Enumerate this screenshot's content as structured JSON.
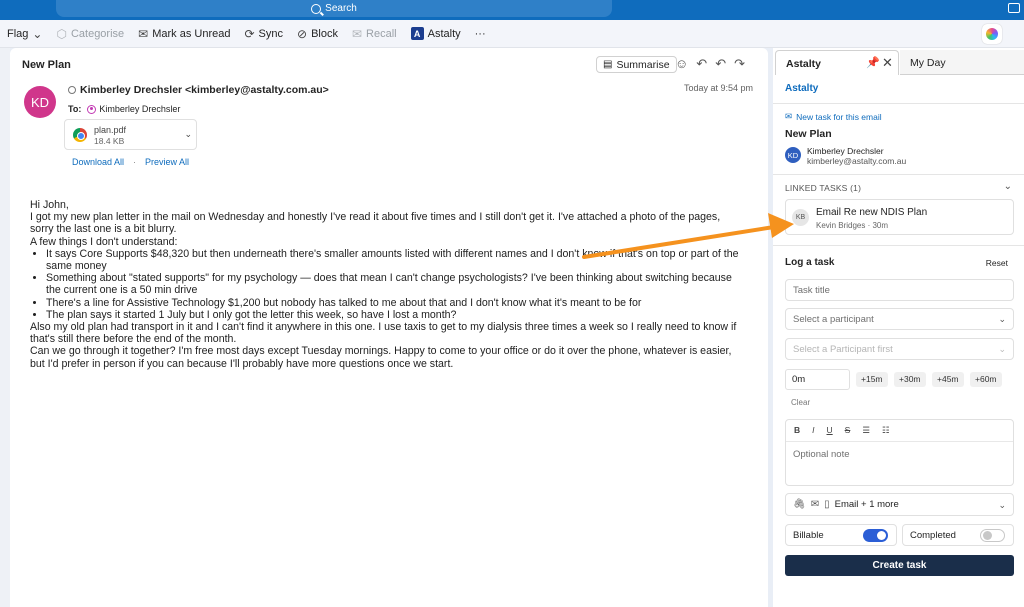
{
  "titlebar": {
    "search_label": "Search"
  },
  "toolbar": {
    "flag": "Flag",
    "categorise": "Categorise",
    "mark_unread": "Mark as Unread",
    "sync": "Sync",
    "block": "Block",
    "recall": "Recall",
    "astalty": "Astalty",
    "more": "···"
  },
  "email": {
    "subject": "New Plan",
    "summarise": "Summarise",
    "sender": "Kimberley Drechsler <kimberley@astalty.com.au>",
    "avatar_initials": "KD",
    "time": "Today at 9:54 pm",
    "to_label": "To:",
    "to_name": "Kimberley Drechsler",
    "attachment": {
      "name": "plan.pdf",
      "size": "18.4 KB"
    },
    "download_all": "Download All",
    "preview_all": "Preview All",
    "body": {
      "greeting": "Hi John,",
      "p1": "I got my new plan letter in the mail on Wednesday and honestly I've read it about five times and I still don't get it. I've attached a photo of the pages, sorry the last one is a bit blurry.",
      "p2": "A few things I don't understand:",
      "bullets": [
        "It says Core Supports $48,320 but then underneath there's smaller amounts listed with different names and I don't know if that's on top or part of the same money",
        "Something about \"stated supports\" for my psychology — does that mean I can't change psychologists? I've been thinking about switching because the current one is a 50 min drive",
        "There's a line for Assistive Technology $1,200 but nobody has talked to me about that and I don't know what it's meant to be for",
        "The plan says it started 1 July but I only got the letter this week, so have I lost a month?"
      ],
      "p3": "Also my old plan had transport in it and I can't find it anywhere in this one. I use taxis to get to my dialysis three times a week so I really need to know if that's still there before the end of the month.",
      "p4": "Can we go through it together? I'm free most days except Tuesday mornings. Happy to come to your office or do it over the phone, whatever is easier, but I'd prefer in person if you can because I'll probably have more questions once we start."
    }
  },
  "panel": {
    "tab_astalty": "Astalty",
    "tab_myday": "My Day",
    "brand": "Astalty",
    "new_task_link": "New task for this email",
    "subject": "New Plan",
    "contact_initials": "KD",
    "contact_name": "Kimberley Drechsler",
    "contact_email": "kimberley@astalty.com.au",
    "linked_header": "LINKED TASKS (1)",
    "linked_task": {
      "initials": "KB",
      "title": "Email Re new NDIS Plan",
      "meta": "Kevin Bridges · 30m"
    },
    "log_header": "Log a task",
    "reset": "Reset",
    "task_title_placeholder": "Task title",
    "participant_placeholder": "Select a participant",
    "participant_first_placeholder": "Select a Participant first",
    "duration": "0m",
    "chips": [
      "+15m",
      "+30m",
      "+45m",
      "+60m"
    ],
    "clear": "Clear",
    "format_buttons": [
      "B",
      "I",
      "U",
      "S",
      "☰",
      "☷"
    ],
    "note_placeholder": "Optional note",
    "attach_label": "Email + 1 more",
    "billable": "Billable",
    "billable_on": true,
    "completed": "Completed",
    "completed_on": false,
    "create": "Create task"
  },
  "colors": {
    "accent": "#0f6cbd",
    "arrow": "#f5921e",
    "avatar": "#d0368b",
    "toggle_on": "#2b5ed6",
    "create_btn": "#1a2e4a"
  }
}
